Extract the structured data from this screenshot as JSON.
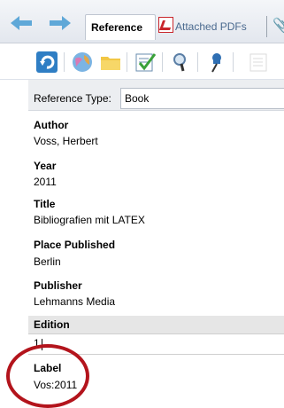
{
  "tabs": {
    "reference_label": "Reference",
    "attached_pdfs_label": "Attached PDFs"
  },
  "toolbar": {
    "icons": [
      "refresh-icon",
      "globe-icon",
      "folder-icon",
      "checklist-icon",
      "find-icon",
      "pushpin-icon"
    ]
  },
  "reference_type": {
    "label": "Reference Type:",
    "value": "Book"
  },
  "fields": {
    "author_label": "Author",
    "author_value": "Voss, Herbert",
    "year_label": "Year",
    "year_value": "2011",
    "title_label": "Title",
    "title_value": "Bibliografien mit LATEX",
    "place_label": "Place Published",
    "place_value": "Berlin",
    "publisher_label": "Publisher",
    "publisher_value": "Lehmanns Media",
    "edition_label": "Edition",
    "edition_value": "1",
    "label_label": "Label",
    "label_value": "Vos:2011"
  },
  "colors": {
    "accent_blue": "#4aa3df",
    "annotation_red": "#b3141c",
    "active_row": "#e6e6e6"
  }
}
